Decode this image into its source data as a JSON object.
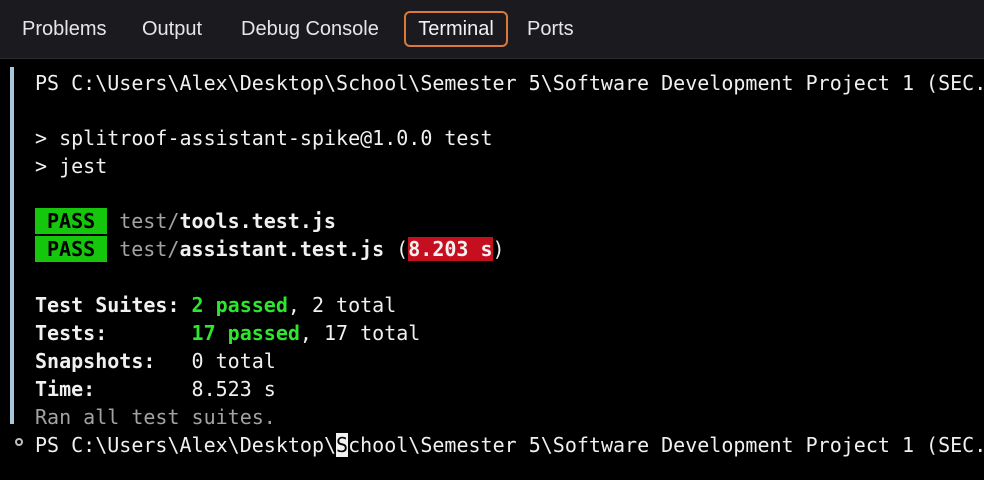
{
  "tabs": [
    {
      "label": "Problems",
      "active": false
    },
    {
      "label": "Output",
      "active": false
    },
    {
      "label": "Debug Console",
      "active": false
    },
    {
      "label": "Terminal",
      "active": true
    },
    {
      "label": "Ports",
      "active": false
    }
  ],
  "terminal": {
    "prompt1": "PS C:\\Users\\Alex\\Desktop\\School\\Semester 5\\Software Development Project 1 (SEC.",
    "npm_line": "> splitroof-assistant-spike@1.0.0 test",
    "jest_line": "> jest",
    "results": [
      {
        "status": "PASS",
        "dir": "test/",
        "file": "tools.test.js",
        "time": ""
      },
      {
        "status": "PASS",
        "dir": "test/",
        "file": "assistant.test.js",
        "time": "8.203 s"
      }
    ],
    "summary": {
      "suites_label": "Test Suites:",
      "suites_passed": "2 passed",
      "suites_total": ", 2 total",
      "tests_label": "Tests:",
      "tests_passed": "17 passed",
      "tests_total": ", 17 total",
      "snapshots_label": "Snapshots:",
      "snapshots_value": "0 total",
      "time_label": "Time:",
      "time_value": "8.523 s"
    },
    "ran_all": "Ran all test suites.",
    "prompt2_before": "PS C:\\Users\\Alex\\Desktop\\",
    "prompt2_cursor": "S",
    "prompt2_after": "chool\\Semester 5\\Software Development Project 1 (SEC."
  },
  "colors": {
    "pass_bg": "#16c60c",
    "time_bg": "#c50f1f",
    "active_tab_border": "#d9793b",
    "passed_text": "#2ee62e"
  }
}
